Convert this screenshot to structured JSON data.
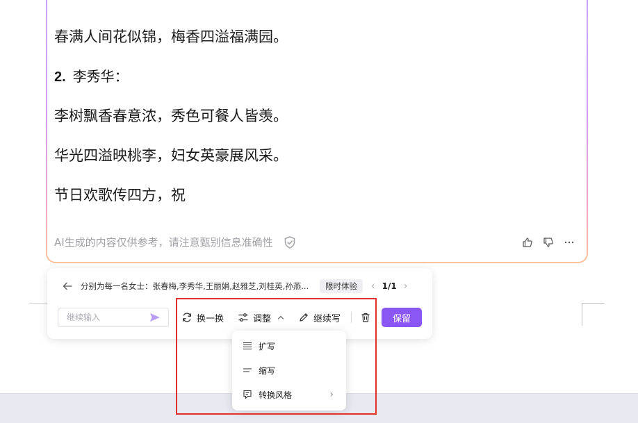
{
  "result": {
    "lines": [
      "春满人间花似锦，梅香四溢福满园。",
      "李树飘香春意浓，秀色可餐人皆羡。",
      "华光四溢映桃李，妇女英豪展风采。",
      "节日欢歌传四方，祝"
    ],
    "heading_number": "2.",
    "heading_text": "李秀华：",
    "disclaimer": "AI生成的内容仅供参考，请注意甄别信息准确性"
  },
  "panel": {
    "prompt": "分别为每一名女士：张春梅,李秀华,王丽娟,赵雅芝,刘桂英,孙燕...",
    "trial_badge": "限时体验",
    "pager_count": "1/1",
    "pager_prev": "‹",
    "pager_next": "›",
    "input_placeholder": "继续输入",
    "buttons": {
      "regenerate": "换一换",
      "adjust": "调整",
      "continue_write": "继续写",
      "keep": "保留"
    }
  },
  "dropdown": {
    "items": [
      {
        "label": "扩写",
        "icon": "expand-lines-icon"
      },
      {
        "label": "缩写",
        "icon": "shrink-lines-icon"
      },
      {
        "label": "转换风格",
        "icon": "style-convert-icon"
      }
    ],
    "submenu_arrow": "›"
  },
  "colors": {
    "accent": "#8a57f5",
    "highlight": "#e0312d",
    "send_arrow": "#b99cf6"
  }
}
